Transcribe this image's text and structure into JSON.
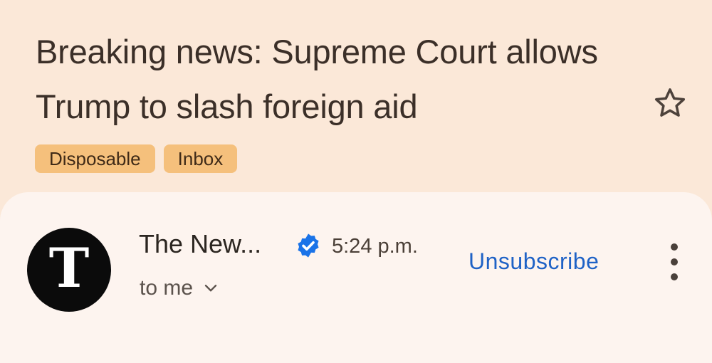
{
  "email": {
    "subject": "Breaking news: Supreme Court allows Trump to slash foreign aid",
    "starred": false,
    "labels": [
      {
        "label": "Disposable",
        "color": "#f5c07c"
      },
      {
        "label": "Inbox",
        "color": "#f5c07c"
      }
    ]
  },
  "header": {
    "sender_name": "The New...",
    "avatar_letter": "T",
    "verified": true,
    "time": "5:24 p.m.",
    "recipient": "to me",
    "unsubscribe_label": "Unsubscribe"
  },
  "colors": {
    "background": "#fbe8d8",
    "card": "#fdf4ef",
    "accent": "#1f62c6",
    "verified_badge": "#1a73e8",
    "avatar_bg": "#0b0b0b"
  },
  "icons": {
    "star": "star-outline-icon",
    "verified": "verified-badge-icon",
    "expand": "chevron-down-icon",
    "more": "more-vert-icon"
  }
}
